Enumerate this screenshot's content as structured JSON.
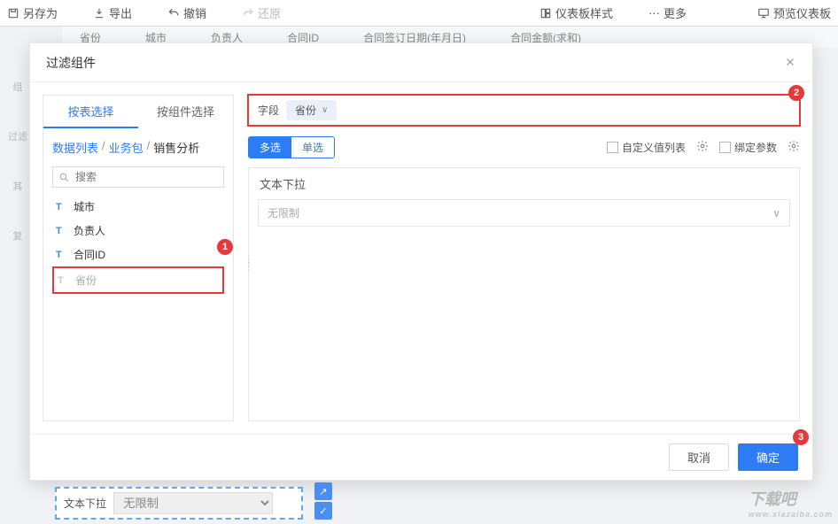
{
  "toolbar": {
    "save_as": "另存为",
    "export": "导出",
    "undo": "撤销",
    "redo": "还原",
    "dashboard_style": "仪表板样式",
    "more": "更多",
    "preview": "预览仪表板"
  },
  "bg_headers": [
    "省份",
    "城市",
    "负责人",
    "合同ID",
    "合同签订日期(年月日)",
    "合同金额(求和)"
  ],
  "bg_left": [
    "组",
    "过滤",
    "其",
    "复"
  ],
  "modal": {
    "title": "过滤组件",
    "tabs": {
      "by_table": "按表选择",
      "by_component": "按组件选择"
    },
    "breadcrumb": {
      "a": "数据列表",
      "b": "业务包",
      "c": "销售分析"
    },
    "search_placeholder": "搜索",
    "fields": [
      {
        "type": "T",
        "label": "城市"
      },
      {
        "type": "T",
        "label": "负责人"
      },
      {
        "type": "T",
        "label": "合同ID"
      },
      {
        "type": "T",
        "label": "省份",
        "selected": true
      }
    ],
    "field_label": "字段",
    "field_value": "省份",
    "multi": "多选",
    "single": "单选",
    "custom_list": "自定义值列表",
    "bind_param": "绑定参数",
    "card_title": "文本下拉",
    "select_value": "无限制",
    "cancel": "取消",
    "ok": "确定"
  },
  "annotations": {
    "a1": "1",
    "a2": "2",
    "a3": "3"
  },
  "bg_widget": {
    "label": "文本下拉",
    "value": "无限制"
  },
  "watermark": {
    "main": "下载吧",
    "sub": "www.xiazaiba.com"
  }
}
